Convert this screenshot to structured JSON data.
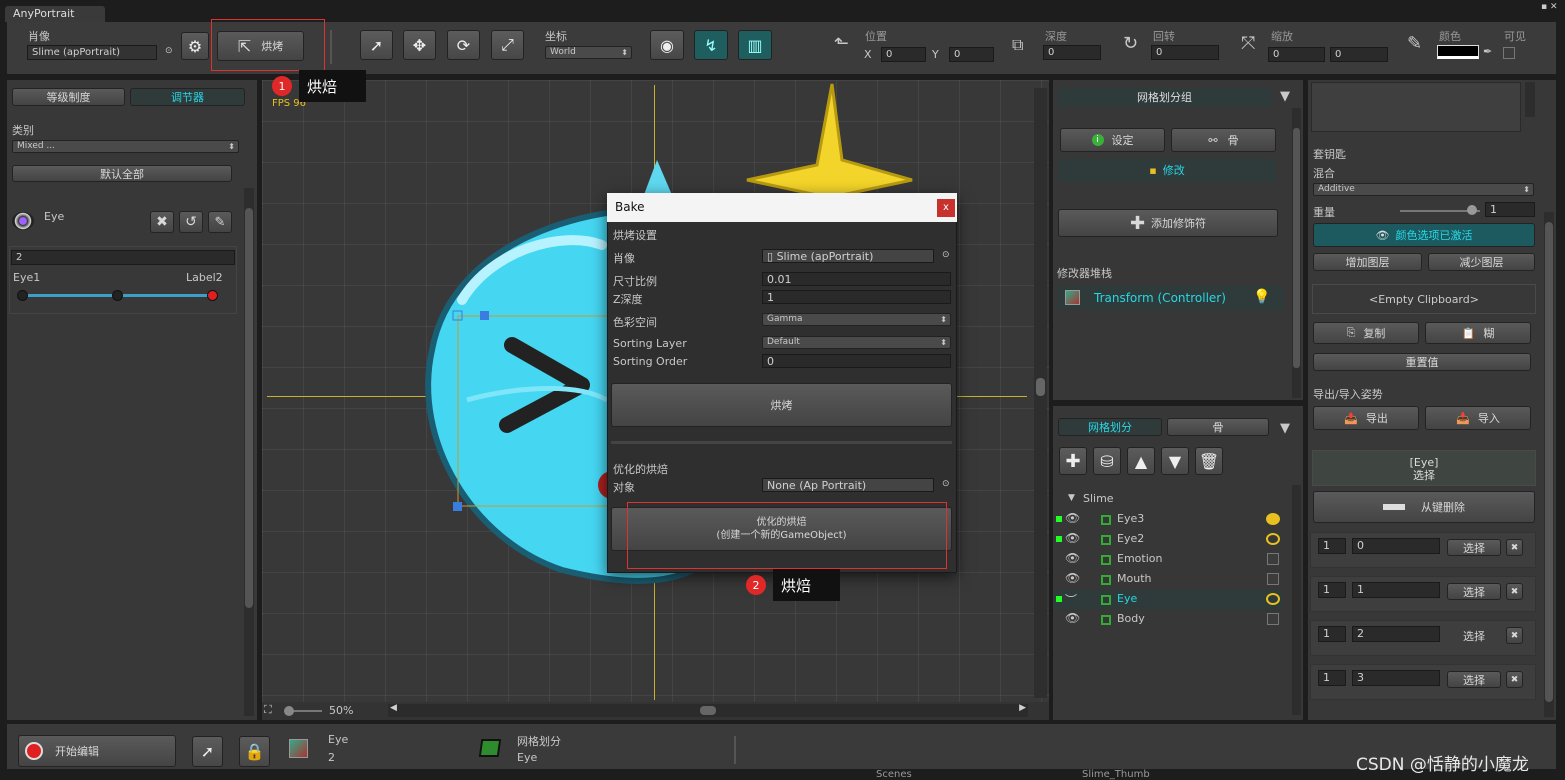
{
  "window": {
    "title": "AnyPortrait"
  },
  "toolbar": {
    "portrait_label": "肖像",
    "portrait_value": "Slime (apPortrait)",
    "bake_label": "烘烤",
    "coord_label": "坐标",
    "coord_value": "World",
    "position_label": "位置",
    "pos_x_label": "X",
    "pos_x": "0",
    "pos_y_label": "Y",
    "pos_y": "0",
    "depth_label": "深度",
    "depth_value": "0",
    "rotation_label": "回转",
    "rotation_value": "0",
    "scale_label": "缩放",
    "scale_x": "0",
    "scale_y": "0",
    "color_label": "颜色",
    "color_value": "#000000",
    "visible_label": "可见"
  },
  "left": {
    "tab_hierarchy": "等级制度",
    "tab_controller": "调节器",
    "category_label": "类别",
    "category_value": "Mixed ...",
    "reset_all": "默认全部",
    "controller_name": "Eye",
    "value_field": "2",
    "slider_left": "Eye1",
    "slider_right": "Label2",
    "slider_knob_positions": [
      0.0,
      0.5,
      1.0
    ]
  },
  "viewport": {
    "fps": "FPS 96",
    "zoom": "50%"
  },
  "bake_dialog": {
    "title": "Bake",
    "close": "x",
    "section_settings": "烘烤设置",
    "portrait_label": "肖像",
    "portrait_value": "Slime (apPortrait)",
    "size_label": "尺寸比例",
    "size_value": "0.01",
    "z_label": "Z深度",
    "z_value": "1",
    "colorspace_label": "色彩空间",
    "colorspace_value": "Gamma",
    "sorting_layer_label": "Sorting Layer",
    "sorting_layer_value": "Default",
    "sorting_order_label": "Sorting Order",
    "sorting_order_value": "0",
    "bake_button": "烘烤",
    "opt_section": "优化的烘焙",
    "target_label": "对象",
    "target_value": "None (Ap Portrait)",
    "opt_button_line1": "优化的烘焙",
    "opt_button_line2": "(创建一个新的GameObject)"
  },
  "annotations": [
    {
      "num": "1",
      "text": "烘焙"
    },
    {
      "num": "2",
      "text": "烘焙"
    }
  ],
  "mesh_panel": {
    "group_title": "网格划分组",
    "setting_button": "设定",
    "bone_button": "骨",
    "modify_label": "修改",
    "add_modifier": "添加修饰符",
    "stack_label": "修改器堆栈",
    "modifier_name": "Transform (Controller)",
    "tab_mesh": "网格划分",
    "tab_bone": "骨",
    "tree_root": "Slime",
    "tree_items": [
      {
        "name": "Eye3",
        "selected": false
      },
      {
        "name": "Eye2",
        "selected": false
      },
      {
        "name": "Emotion",
        "selected": false
      },
      {
        "name": "Mouth",
        "selected": false
      },
      {
        "name": "Eye",
        "selected": true
      },
      {
        "name": "Body",
        "selected": false
      }
    ]
  },
  "right": {
    "keyframe_label": "套钥匙",
    "blend_label": "混合",
    "blend_value": "Additive",
    "weight_label": "重量",
    "weight_value": "1",
    "weight_fraction": 0.9,
    "color_option_active": "颜色选项已激活",
    "add_layer": "增加图层",
    "remove_layer": "减少图层",
    "clipboard": "<Empty Clipboard>",
    "copy": "复制",
    "paste": "糊",
    "reset_value": "重置值",
    "pose_label": "导出/导入姿势",
    "export": "导出",
    "import": "导入",
    "selected_title": "[Eye]",
    "selected_sub": "选择",
    "remove_key": "从键删除",
    "rows": [
      {
        "index": "1",
        "value": "0",
        "button": "选择"
      },
      {
        "index": "1",
        "value": "1",
        "button": "选择"
      },
      {
        "index": "1",
        "value": "2",
        "button": "选择"
      },
      {
        "index": "1",
        "value": "3",
        "button": "选择"
      }
    ]
  },
  "bottom": {
    "start_edit": "开始编辑",
    "info1_title": "Eye",
    "info1_value": "2",
    "info2_title": "网格划分",
    "info2_value": "Eye"
  },
  "desktop": {
    "scenes": "Scenes",
    "slime_thumb": "Slime_Thumb",
    "watermark": "CSDN @恬静的小魔龙"
  }
}
